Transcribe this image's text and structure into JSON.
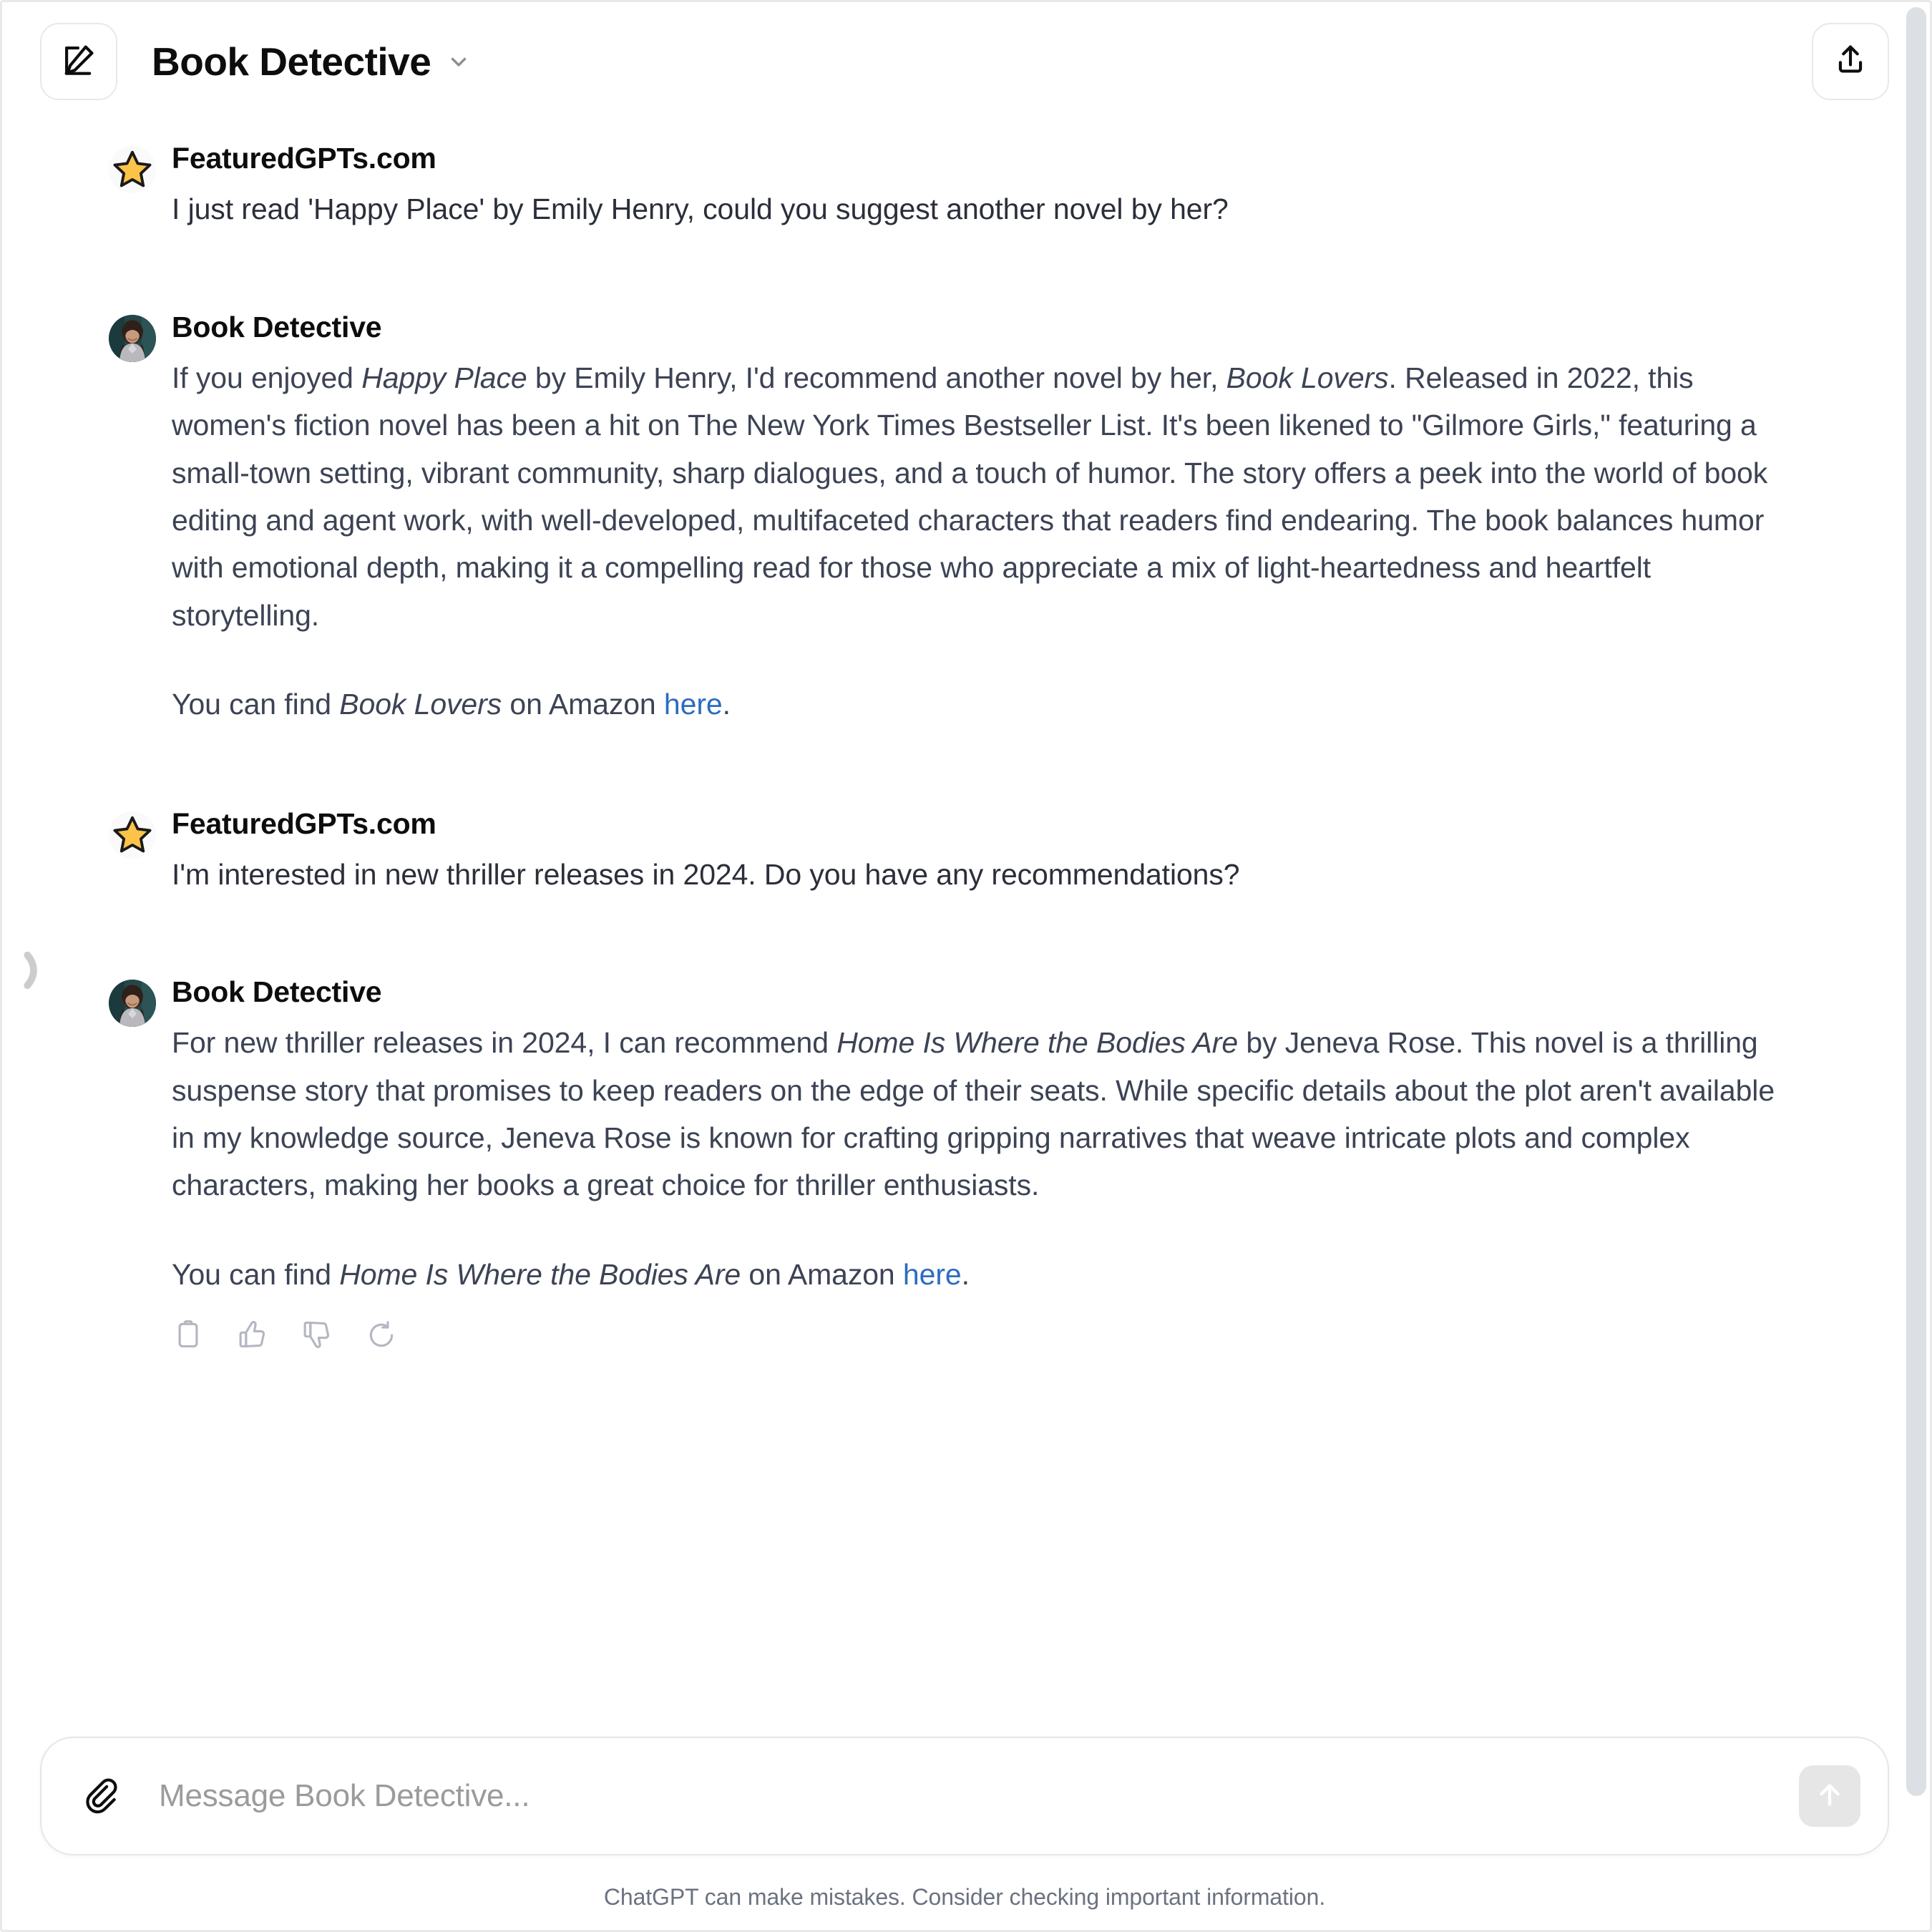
{
  "header": {
    "title": "Book Detective",
    "new_chat_icon": "compose-icon",
    "model_chevron_icon": "chevron-down-icon",
    "share_icon": "share-upload-icon"
  },
  "sidebar": {
    "expand_handle_icon": "sidebar-expand-icon"
  },
  "conversation": [
    {
      "role": "user",
      "sender": "FeaturedGPTs.com",
      "avatar": "star-avatar",
      "paragraphs": [
        [
          {
            "t": "text",
            "v": "I just read 'Happy Place' by Emily Henry, could you suggest another novel by her?"
          }
        ]
      ]
    },
    {
      "role": "assistant",
      "sender": "Book Detective",
      "avatar": "book-detective-photo-avatar",
      "paragraphs": [
        [
          {
            "t": "text",
            "v": "If you enjoyed "
          },
          {
            "t": "em",
            "v": "Happy Place"
          },
          {
            "t": "text",
            "v": " by Emily Henry, I'd recommend another novel by her, "
          },
          {
            "t": "em",
            "v": "Book Lovers"
          },
          {
            "t": "text",
            "v": ". Released in 2022, this women's fiction novel has been a hit on The New York Times Bestseller List. It's been likened to \"Gilmore Girls,\" featuring a small-town setting, vibrant community, sharp dialogues, and a touch of humor. The story offers a peek into the world of book editing and agent work, with well-developed, multifaceted characters that readers find endearing. The book balances humor with emotional depth, making it a compelling read for those who appreciate a mix of light-heartedness and heartfelt storytelling."
          }
        ],
        [
          {
            "t": "text",
            "v": "You can find "
          },
          {
            "t": "em",
            "v": "Book Lovers"
          },
          {
            "t": "text",
            "v": " on Amazon "
          },
          {
            "t": "link",
            "v": "here"
          },
          {
            "t": "text",
            "v": "."
          }
        ]
      ]
    },
    {
      "role": "user",
      "sender": "FeaturedGPTs.com",
      "avatar": "star-avatar",
      "paragraphs": [
        [
          {
            "t": "text",
            "v": "I'm interested in new thriller releases in 2024. Do you have any recommendations?"
          }
        ]
      ]
    },
    {
      "role": "assistant",
      "sender": "Book Detective",
      "avatar": "book-detective-photo-avatar",
      "paragraphs": [
        [
          {
            "t": "text",
            "v": "For new thriller releases in 2024, I can recommend "
          },
          {
            "t": "em",
            "v": "Home Is Where the Bodies Are"
          },
          {
            "t": "text",
            "v": " by Jeneva Rose. This novel is a thrilling suspense story that promises to keep readers on the edge of their seats. While specific details about the plot aren't available in my knowledge source, Jeneva Rose is known for crafting gripping narratives that weave intricate plots and complex characters, making her books a great choice for thriller enthusiasts."
          }
        ],
        [
          {
            "t": "text",
            "v": "You can find "
          },
          {
            "t": "em",
            "v": "Home Is Where the Bodies Are"
          },
          {
            "t": "text",
            "v": " on Amazon "
          },
          {
            "t": "link",
            "v": "here"
          },
          {
            "t": "text",
            "v": "."
          }
        ]
      ],
      "actions": [
        {
          "name": "copy-button",
          "icon": "clipboard-icon"
        },
        {
          "name": "thumbs-up-button",
          "icon": "thumbs-up-icon"
        },
        {
          "name": "thumbs-down-button",
          "icon": "thumbs-down-icon"
        },
        {
          "name": "regenerate-button",
          "icon": "refresh-icon"
        }
      ]
    }
  ],
  "scroll_to_bottom": {
    "icon": "arrow-down-icon"
  },
  "composer": {
    "attach_icon": "paperclip-icon",
    "placeholder": "Message Book Detective...",
    "value": "",
    "send_icon": "arrow-up-icon",
    "send_disabled": true
  },
  "footer": {
    "disclaimer": "ChatGPT can make mistakes. Consider checking important information."
  },
  "colors": {
    "link": "#2d6cc0",
    "body_text": "#3c4354",
    "heading": "#0d0d0d",
    "star_fill": "#fbc34a",
    "send_bg": "#e6e6e6",
    "scrollbar": "#dcdfe4"
  }
}
